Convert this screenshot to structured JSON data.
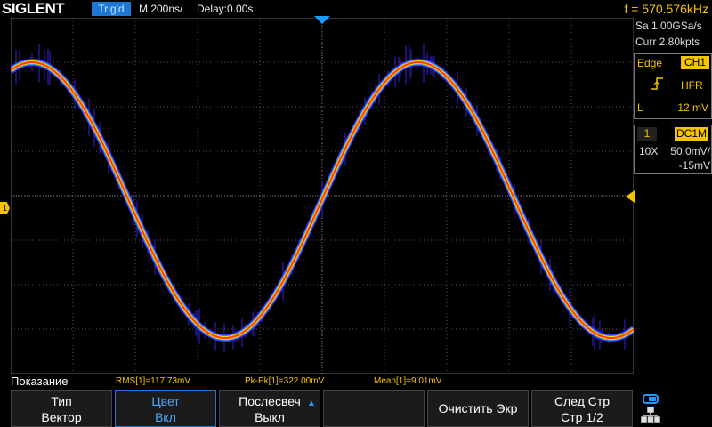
{
  "header": {
    "logo": "SIGLENT",
    "trigger_status": "Trig'd",
    "timebase": "M 200ns/",
    "delay": "Delay:0.00s",
    "frequency": "f = 570.576kHz"
  },
  "acquisition": {
    "sample_rate": "Sa 1.00GSa/s",
    "memory": "Curr 2.80kpts"
  },
  "trigger_panel": {
    "type": "Edge",
    "source": "CH1",
    "slope_icon": "rising-edge-icon",
    "coupling": "HFR",
    "level_label": "L",
    "level": "12 mV"
  },
  "channel_panel": {
    "number": "1",
    "coupling": "DC1M",
    "probe": "10X",
    "scale": "50.0mV/",
    "offset": "-15mV"
  },
  "measurements": {
    "title": "Показание",
    "items": [
      "RMS[1]=117.73mV",
      "Pk-Pk[1]=322.00mV",
      "Mean[1]=9.01mV"
    ]
  },
  "softkeys": [
    {
      "line1": "Тип",
      "line2": "Вектор"
    },
    {
      "line1": "Цвет",
      "line2": "Вкл"
    },
    {
      "line1": "Послесвеч",
      "line2": "Выкл"
    },
    {
      "line1": "",
      "line2": ""
    },
    {
      "line1": "Очистить Экр",
      "line2": ""
    },
    {
      "line1": "След Стр",
      "line2": "Стр 1/2"
    }
  ],
  "markers": {
    "channel_ground": "1"
  },
  "colors": {
    "accent_yellow": "#f5c400",
    "accent_blue": "#1c78d4",
    "trace_outer": "#3a2cff",
    "trace_core": "#ff3b00"
  }
}
